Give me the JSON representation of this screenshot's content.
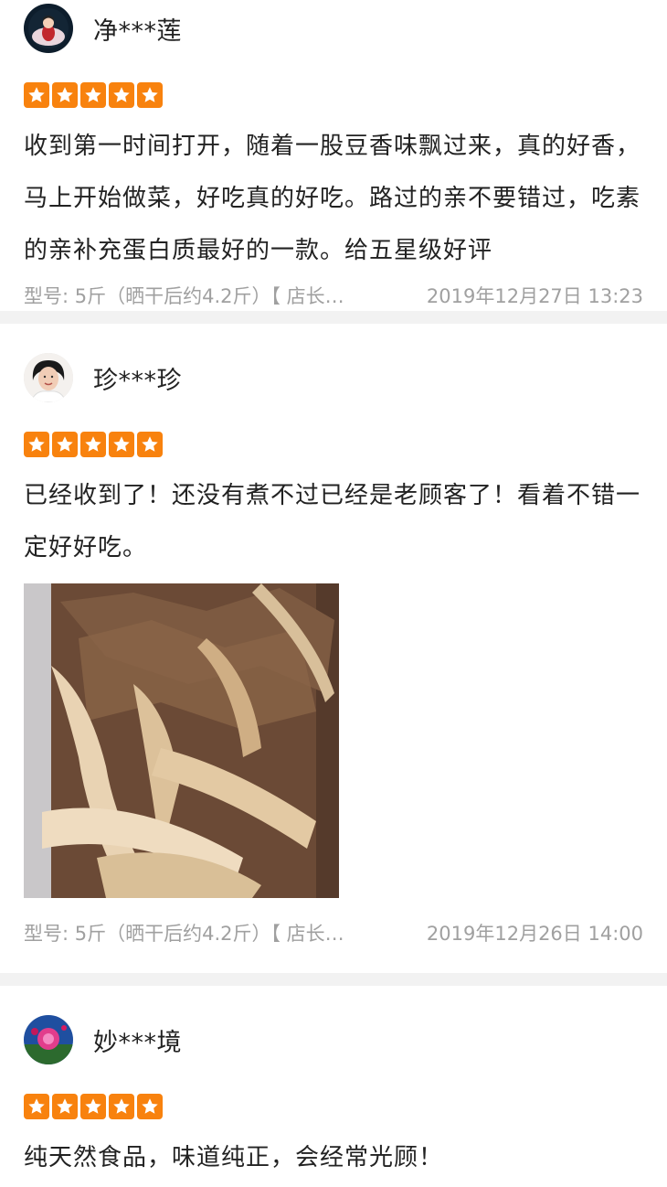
{
  "reviews": [
    {
      "username": "净***莲",
      "rating": 5,
      "content": "收到第一时间打开，随着一股豆香味飘过来，真的好香，马上开始做菜，好吃真的好吃。路过的亲不要错过，吃素的亲补充蛋白质最好的一款。给五星级好评",
      "spec": "型号: 5斤（晒干后约4.2斤）【 店长…",
      "date": "2019年12月27日 13:23"
    },
    {
      "username": "珍***珍",
      "rating": 5,
      "content": "已经收到了！还没有煮不过已经是老顾客了！看着不错一定好好吃。",
      "spec": "型号: 5斤（晒干后约4.2斤）【 店长…",
      "date": "2019年12月26日 14:00"
    },
    {
      "username": "妙***境",
      "rating": 5,
      "content": "纯天然食品，味道纯正，会经常光顾！"
    }
  ],
  "colors": {
    "star": "#f8820e",
    "meta_text": "#a0a0a0",
    "separator": "#f2f2f2"
  },
  "icons": {
    "star": "star-icon"
  }
}
